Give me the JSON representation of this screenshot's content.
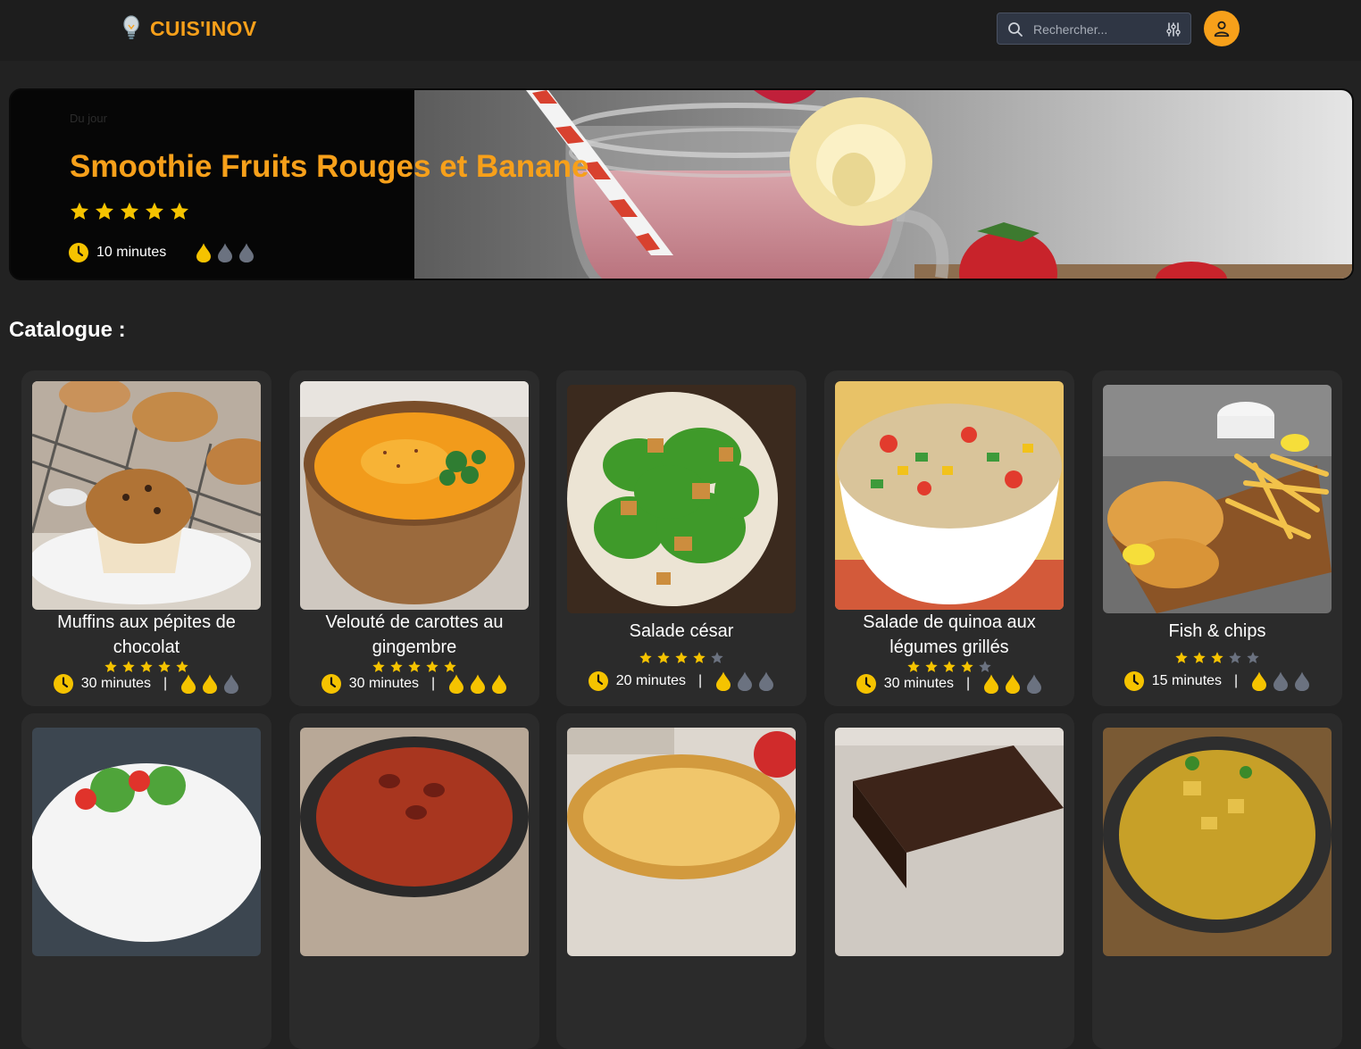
{
  "header": {
    "brand": "CUIS'INOV",
    "search_placeholder": "Rechercher...",
    "logo_icon": "lightbulb-icon",
    "filter_icon": "sliders-icon",
    "user_icon": "user-icon"
  },
  "colors": {
    "accent": "#f7a01a",
    "star": "#f5c300",
    "muted": "#6b7280",
    "card": "#2b2b2b"
  },
  "hero": {
    "kicker": "Du jour",
    "title": "Smoothie Fruits Rouges et Banane",
    "rating": 5,
    "time": "10 minutes",
    "difficulty": 1
  },
  "catalogue": {
    "title": "Catalogue :",
    "items": [
      {
        "name": "Muffins aux pépites de chocolat",
        "rating": 5,
        "time": "30 minutes",
        "difficulty": 2,
        "image": "muffins"
      },
      {
        "name": "Velouté de carottes au gingembre",
        "rating": 5,
        "time": "30 minutes",
        "difficulty": 3,
        "image": "soup"
      },
      {
        "name": "Salade césar",
        "rating": 4,
        "time": "20 minutes",
        "difficulty": 1,
        "image": "caesar"
      },
      {
        "name": "Salade de quinoa aux légumes grillés",
        "rating": 4,
        "time": "30 minutes",
        "difficulty": 2,
        "image": "quinoa"
      },
      {
        "name": "Fish & chips",
        "rating": 3,
        "time": "15 minutes",
        "difficulty": 1,
        "image": "fish"
      },
      {
        "name": "",
        "image": "salad2"
      },
      {
        "name": "",
        "image": "chili"
      },
      {
        "name": "",
        "image": "tart"
      },
      {
        "name": "",
        "image": "brownie"
      },
      {
        "name": "",
        "image": "curry"
      }
    ],
    "separator": "|"
  }
}
